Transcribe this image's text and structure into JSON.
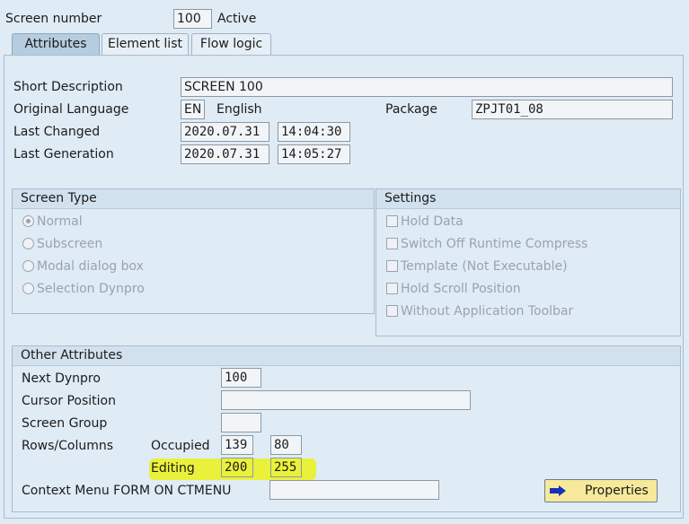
{
  "header": {
    "screen_number_label": "Screen number",
    "screen_number": "100",
    "status": "Active"
  },
  "tabs": [
    {
      "label": "Attributes",
      "active": true
    },
    {
      "label": "Element list",
      "active": false
    },
    {
      "label": "Flow logic",
      "active": false
    }
  ],
  "attributes": {
    "short_description_label": "Short Description",
    "short_description": "SCREEN 100",
    "original_language_label": "Original Language",
    "language_code": "EN",
    "language_name": "English",
    "package_label": "Package",
    "package": "ZPJT01_08",
    "last_changed_label": "Last Changed",
    "last_changed_date": "2020.07.31",
    "last_changed_time": "14:04:30",
    "last_generation_label": "Last Generation",
    "last_generation_date": "2020.07.31",
    "last_generation_time": "14:05:27"
  },
  "screen_type": {
    "title": "Screen Type",
    "options": [
      "Normal",
      "Subscreen",
      "Modal dialog box",
      "Selection Dynpro"
    ],
    "selected": "Normal"
  },
  "settings": {
    "title": "Settings",
    "options": [
      "Hold Data",
      "Switch Off Runtime Compress",
      "Template (Not Executable)",
      "Hold Scroll Position",
      "Without Application Toolbar"
    ]
  },
  "other": {
    "title": "Other Attributes",
    "next_dynpro_label": "Next Dynpro",
    "next_dynpro": "100",
    "cursor_position_label": "Cursor Position",
    "cursor_position": "",
    "screen_group_label": "Screen Group",
    "screen_group": "",
    "rows_columns_label": "Rows/Columns",
    "occupied_label": "Occupied",
    "occupied_rows": "139",
    "occupied_cols": "80",
    "editing_label": "Editing",
    "editing_rows": "200",
    "editing_cols": "255",
    "context_menu_label": "Context Menu FORM ON CTMENU",
    "context_menu": "",
    "properties_button": "Properties"
  },
  "colors": {
    "highlight": "#e9f13a",
    "button": "#f7e99a",
    "arrow": "#1a2fb8"
  }
}
